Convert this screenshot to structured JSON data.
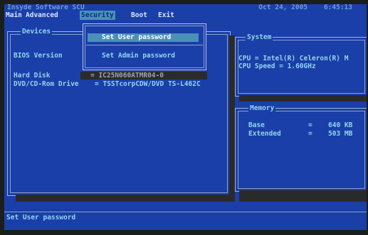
{
  "header": {
    "vendor": "Insyde Software SCU",
    "date": "Oct 24, 2005",
    "time": "6:45:13"
  },
  "menu": [
    {
      "label": "Main"
    },
    {
      "label": "Advanced"
    },
    {
      "label": "Security"
    },
    {
      "label": "Boot"
    },
    {
      "label": "Exit"
    }
  ],
  "devices_panel": {
    "title": "Devices",
    "bios_label": "BIOS Version",
    "hdd_label": "Hard Disk",
    "hdd_value": "IC25N060ATMR04-0",
    "dvd_label": "DVD/CD-Rom Drive",
    "dvd_value": "= TSSTcorpCDW/DVD TS-L462C"
  },
  "security_menu": {
    "items": [
      {
        "label": "Set User password"
      },
      {
        "label": "Set Admin password"
      }
    ]
  },
  "system_panel": {
    "title": "System",
    "cpu": "CPU = Intel(R) Celeron(R) M",
    "cpu_speed": "CPU Speed = 1.60GHz"
  },
  "memory_panel": {
    "title": "Memory",
    "base_label": "Base",
    "base_eq": "=",
    "base_value": "640 KB",
    "ext_label": "Extended",
    "ext_eq": "=",
    "ext_value": "503 MB"
  },
  "status": {
    "message": "Set User password"
  }
}
